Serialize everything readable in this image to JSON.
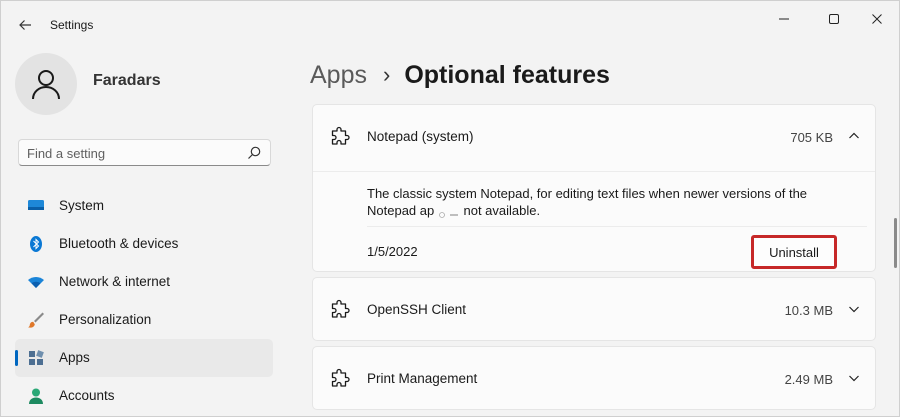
{
  "window": {
    "title": "Settings",
    "icons": {
      "back": "arrow-left-icon",
      "minimize": "minimize-icon",
      "maximize": "maximize-icon",
      "close": "close-icon"
    }
  },
  "profile": {
    "name": "Faradars",
    "icon": "user-avatar-icon"
  },
  "search": {
    "placeholder": "Find a setting",
    "value": "",
    "icon": "search-icon"
  },
  "sidebar": {
    "items": [
      {
        "label": "System",
        "icon": "monitor-icon",
        "color": "#0078d4",
        "active": false
      },
      {
        "label": "Bluetooth & devices",
        "icon": "bluetooth-icon",
        "color": "#0078d4",
        "active": false
      },
      {
        "label": "Network & internet",
        "icon": "wifi-icon",
        "color": "#0a7fd1",
        "active": false
      },
      {
        "label": "Personalization",
        "icon": "brush-icon",
        "color": "#e06c1e",
        "active": false
      },
      {
        "label": "Apps",
        "icon": "apps-icon",
        "color": "#4a6a8a",
        "active": true
      },
      {
        "label": "Accounts",
        "icon": "person-icon",
        "color": "#2aa876",
        "active": false
      }
    ]
  },
  "breadcrumb": {
    "parent": "Apps",
    "separator": "›",
    "current": "Optional features"
  },
  "features": [
    {
      "name": "Notepad (system)",
      "size": "705 KB",
      "expanded": true,
      "description_line1": "The classic system Notepad, for editing text files when newer versions of the",
      "description_line2": "Notepad ap",
      "description_line3": "not available.",
      "date": "1/5/2022",
      "uninstall_label": "Uninstall"
    },
    {
      "name": "OpenSSH Client",
      "size": "10.3 MB",
      "expanded": false
    },
    {
      "name": "Print Management",
      "size": "2.49 MB",
      "expanded": false
    }
  ],
  "colors": {
    "accent": "#0067c0",
    "highlight_border": "#c62828"
  }
}
